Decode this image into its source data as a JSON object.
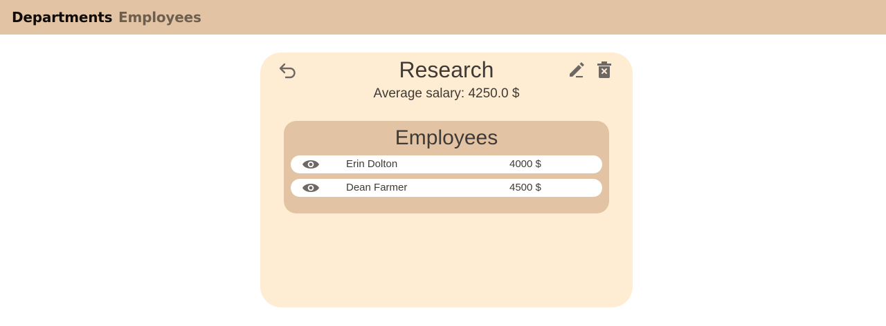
{
  "nav": {
    "departments_label": "Departments",
    "employees_label": "Employees"
  },
  "department": {
    "name": "Research",
    "avg_salary_label": "Average salary:",
    "avg_salary_value": "4250.0 $"
  },
  "employees_panel": {
    "title": "Employees",
    "rows": [
      {
        "name": "Erin Dolton",
        "salary": "4000 $"
      },
      {
        "name": "Dean Farmer",
        "salary": "4500 $"
      }
    ]
  },
  "icons": {
    "back": "undo-arrow-icon",
    "edit": "pencil-icon",
    "delete": "trash-icon",
    "view": "eye-icon"
  },
  "colors": {
    "topbar": "#e2c4a4",
    "card": "#ffedd3",
    "panel": "#e2c4a4",
    "text": "#3f3a36",
    "icon": "#6e6864"
  }
}
